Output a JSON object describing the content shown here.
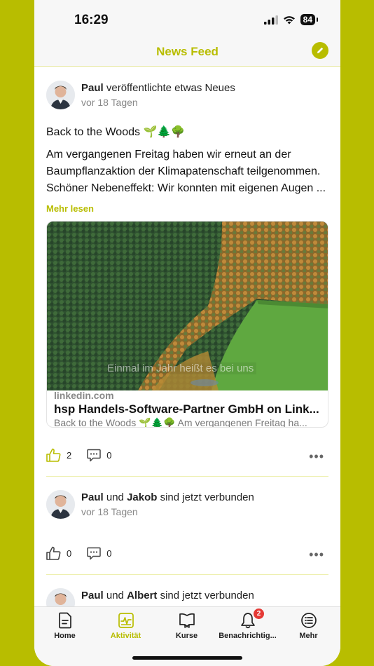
{
  "status": {
    "time": "16:29",
    "battery": "84"
  },
  "nav": {
    "title": "News Feed",
    "edit_icon": "pencil-icon"
  },
  "posts": [
    {
      "author": "Paul",
      "action": "veröffentlichte etwas Neues",
      "time": "vor 18 Tagen",
      "title": "Back to the Woods 🌱🌲🌳",
      "body": "Am vergangenen Freitag haben wir erneut an der Baumpflanzaktion der Klimapatenschaft teilgenommen. Schöner Nebeneffekt: Wir konnten mit eigenen Augen ...",
      "more": "Mehr lesen",
      "link": {
        "overlay": "Einmal im Jahr heißt es bei uns",
        "domain": "linkedin.com",
        "title": "hsp Handels-Software-Partner GmbH on Link...",
        "desc": "Back to the Woods 🌱🌲🌳 Am vergangenen Freitag ha..."
      },
      "likes": "2",
      "comments": "0",
      "liked": true
    },
    {
      "author": "Paul",
      "connector": "und",
      "author2": "Jakob",
      "action": "sind jetzt verbunden",
      "time": "vor 18 Tagen",
      "likes": "0",
      "comments": "0"
    },
    {
      "author": "Paul",
      "connector": "und",
      "author2": "Albert",
      "action": "sind jetzt verbunden"
    }
  ],
  "tabs": [
    {
      "label": "Home",
      "icon": "document-icon"
    },
    {
      "label": "Aktivität",
      "icon": "activity-icon",
      "active": true
    },
    {
      "label": "Kurse",
      "icon": "book-icon"
    },
    {
      "label": "Benachrichtig...",
      "icon": "bell-icon",
      "badge": "2"
    },
    {
      "label": "Mehr",
      "icon": "list-icon"
    }
  ],
  "colors": {
    "accent": "#b8bd00",
    "badge": "#e53935"
  }
}
